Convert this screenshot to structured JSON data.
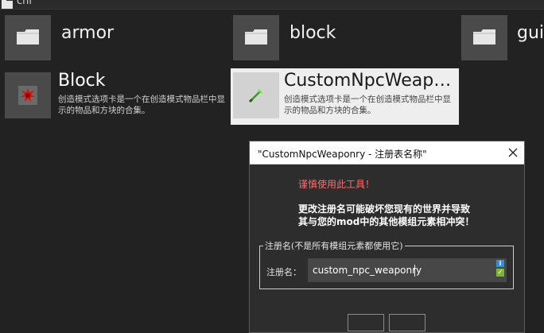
{
  "topbar": {
    "folder_label": "cni"
  },
  "folders": [
    {
      "label": "armor",
      "icon": "folder-icon"
    },
    {
      "label": "block",
      "icon": "folder-icon"
    },
    {
      "label": "gui",
      "icon": "folder-icon"
    }
  ],
  "tabs": [
    {
      "title": "Block",
      "description": "创造模式选项卡是一个在创造模式物品栏中显示的物品和方块的合集。",
      "icon": "red-block-icon"
    },
    {
      "title": "CustomNpcWeap…",
      "description": "创造模式选项卡是一个在创造模式物品栏中显示的物品和方块的合集。",
      "icon": "weapon-icon"
    }
  ],
  "dialog": {
    "title": "\"CustomNpcWeaponry - 注册表名称\"",
    "warning_title": "谨慎使用此工具！",
    "warning_line1": "更改注册名可能破坏您现有的世界并导致",
    "warning_line2": "其与您的mod中的其他模组元素相冲突！",
    "group_label": "注册名(不是所有模组元素都使用它)",
    "field_label": "注册名：",
    "field_value": "custom_npc_weaponry"
  },
  "colors": {
    "background": "#222222",
    "warning_text": "#ff6c6c",
    "selected_card": "#eeeeee",
    "info_badge": "#2f8fd8",
    "check_badge": "#7cb82f"
  }
}
